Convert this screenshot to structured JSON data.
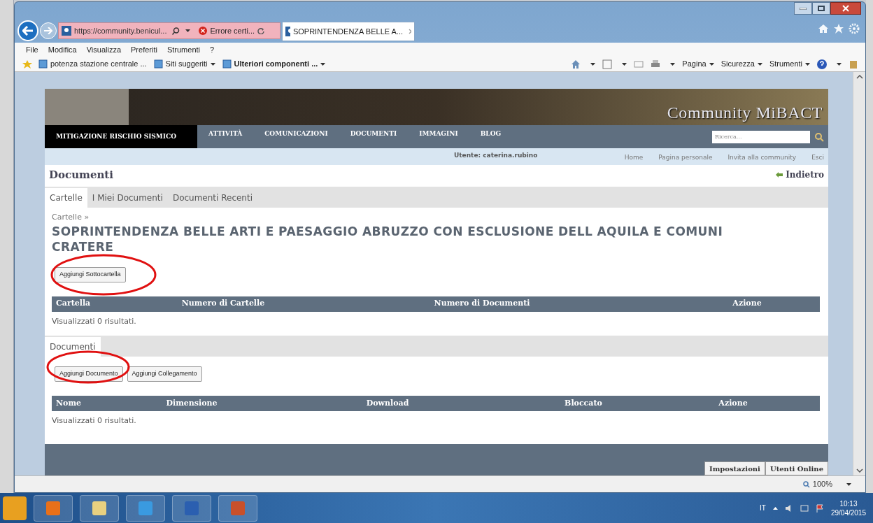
{
  "browser": {
    "address": "https://community.benicul...",
    "cert_error": "Errore certi...",
    "tabs": [
      {
        "label": "SOPRINTENDENZA BELLE A...",
        "selected": true
      }
    ],
    "menu": [
      "File",
      "Modifica",
      "Visualizza",
      "Preferiti",
      "Strumenti",
      "?"
    ],
    "favorites": [
      {
        "label": "potenza stazione centrale ...",
        "dropdown": false,
        "bold": false
      },
      {
        "label": "Siti suggeriti",
        "dropdown": true,
        "bold": false
      },
      {
        "label": "Ulteriori componenti ...",
        "dropdown": true,
        "bold": true
      }
    ],
    "commands": [
      "Pagina",
      "Sicurezza",
      "Strumenti"
    ]
  },
  "page": {
    "banner_title": "Community MiBACT",
    "section": "MITIGAZIONE RISCHIO SISMICO",
    "nav": [
      "ATTIVITÀ",
      "COMUNICAZIONI",
      "DOCUMENTI",
      "IMMAGINI",
      "BLOG"
    ],
    "search": {
      "placeholder": "Ricerca..."
    },
    "user": "Utente: caterina.rubino",
    "user_links": [
      "Home",
      "Pagina personale",
      "Invita alla community",
      "Esci"
    ],
    "heading": "Documenti",
    "back_link": "Indietro",
    "tabs": [
      {
        "label": "Cartelle",
        "selected": true
      },
      {
        "label": "I Miei Documenti",
        "selected": false
      },
      {
        "label": "Documenti Recenti",
        "selected": false
      }
    ],
    "breadcrumb": "Cartelle »",
    "folder_title": "SOPRINTENDENZA BELLE ARTI E PAESAGGIO ABRUZZO CON ESCLUSIONE DELL AQUILA E COMUNI CRATERE",
    "folder_buttons": [
      "Aggiungi Sottocartella"
    ],
    "folders_table": {
      "columns": [
        "Cartella",
        "Numero di Cartelle",
        "Numero di Documenti",
        "Azione"
      ],
      "summary": "Visualizzati 0 risultati."
    },
    "documents_tabs": [
      {
        "label": "Documenti",
        "selected": true
      }
    ],
    "document_buttons": [
      "Aggiungi Documento",
      "Aggiungi Collegamento"
    ],
    "documents_table": {
      "columns": [
        "Nome",
        "Dimensione",
        "Download",
        "Bloccato",
        "Azione"
      ],
      "summary": "Visualizzati 0 risultati."
    },
    "footer_tabs": [
      "Impostazioni",
      "Utenti Online"
    ]
  },
  "status_bar": {
    "zoom": "100%"
  },
  "taskbar": {
    "language": "IT",
    "time": "10:13",
    "date": "29/04/2015"
  }
}
